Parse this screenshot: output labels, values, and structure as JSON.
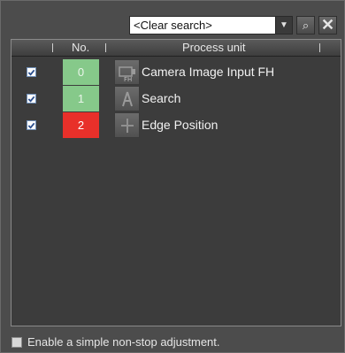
{
  "search": {
    "value": "<Clear search>"
  },
  "toolbar": {
    "search_icon": "magnifier-icon",
    "close_icon": "close-icon"
  },
  "table": {
    "headers": {
      "no": "No.",
      "unit": "Process unit"
    },
    "rows": [
      {
        "checked": true,
        "no": "0",
        "status": "ok",
        "status_color": "#86c98a",
        "icon": "camera-fh-icon",
        "label": "Camera Image Input FH"
      },
      {
        "checked": true,
        "no": "1",
        "status": "ok",
        "status_color": "#86c98a",
        "icon": "search-unit-icon",
        "label": "Search"
      },
      {
        "checked": true,
        "no": "2",
        "status": "ng",
        "status_color": "#e8302a",
        "icon": "edge-position-icon",
        "label": "Edge Position"
      }
    ]
  },
  "footer": {
    "checkbox_label": "Enable a simple non-stop adjustment.",
    "checked": false
  }
}
